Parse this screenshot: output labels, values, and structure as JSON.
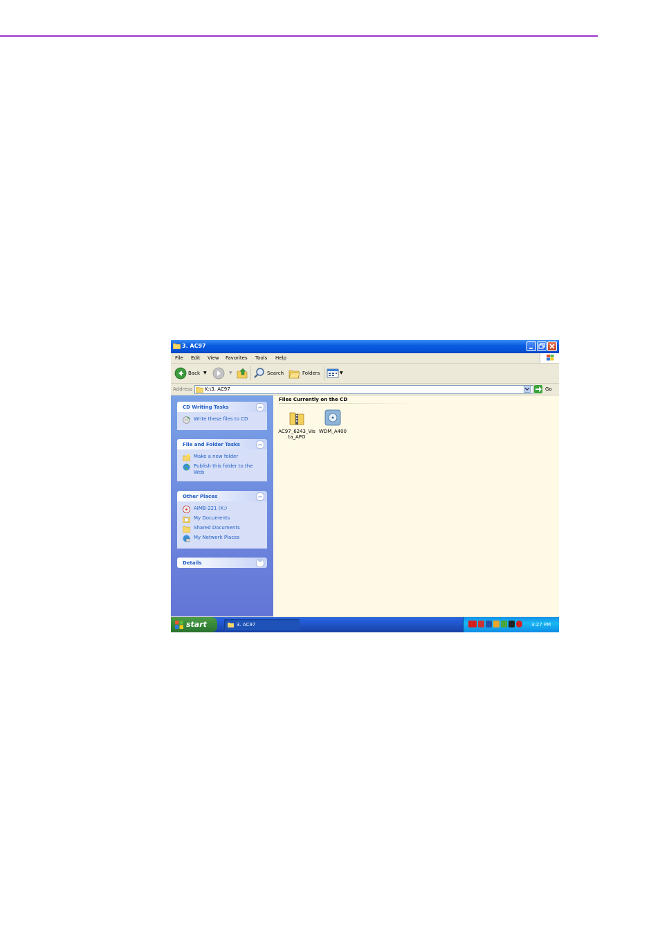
{
  "window": {
    "title": "3. AC97",
    "controls": [
      "minimize-icon",
      "maximize-icon",
      "close-icon"
    ]
  },
  "menu": [
    "File",
    "Edit",
    "View",
    "Favorites",
    "Tools",
    "Help"
  ],
  "toolbar": {
    "back_label": "Back",
    "search_label": "Search",
    "folders_label": "Folders"
  },
  "address": {
    "label": "Address",
    "value": "K:\\3. AC97",
    "go_label": "Go"
  },
  "sidebar": {
    "cd_tasks": {
      "title": "CD Writing Tasks",
      "items": [
        {
          "label": "Write these files to CD",
          "icon": "cd-write-icon"
        }
      ]
    },
    "file_tasks": {
      "title": "File and Folder Tasks",
      "items": [
        {
          "label": "Make a new folder",
          "icon": "new-folder-icon"
        },
        {
          "label": "Publish this folder to the Web",
          "icon": "publish-web-icon"
        }
      ]
    },
    "other_places": {
      "title": "Other Places",
      "items": [
        {
          "label": "AIMB-221 (K:)",
          "icon": "cd-drive-icon"
        },
        {
          "label": "My Documents",
          "icon": "folder-icon"
        },
        {
          "label": "Shared Documents",
          "icon": "folder-icon"
        },
        {
          "label": "My Network Places",
          "icon": "network-places-icon"
        }
      ]
    },
    "details": {
      "title": "Details"
    }
  },
  "content": {
    "group_header": "Files Currently on the CD",
    "files": [
      {
        "name": "AC97_6243_Vista_APO",
        "icon": "zip-folder-icon"
      },
      {
        "name": "WDM_A400",
        "icon": "installer-icon"
      }
    ]
  },
  "taskbar": {
    "start_label": "start",
    "task_item": "3. AC97",
    "clock": "3:27 PM"
  },
  "colors": {
    "header_rule": "#9b30c8",
    "title_bar": "#0a5de0",
    "sidebar_link": "#215dc6",
    "content_bg": "#fffae6"
  }
}
